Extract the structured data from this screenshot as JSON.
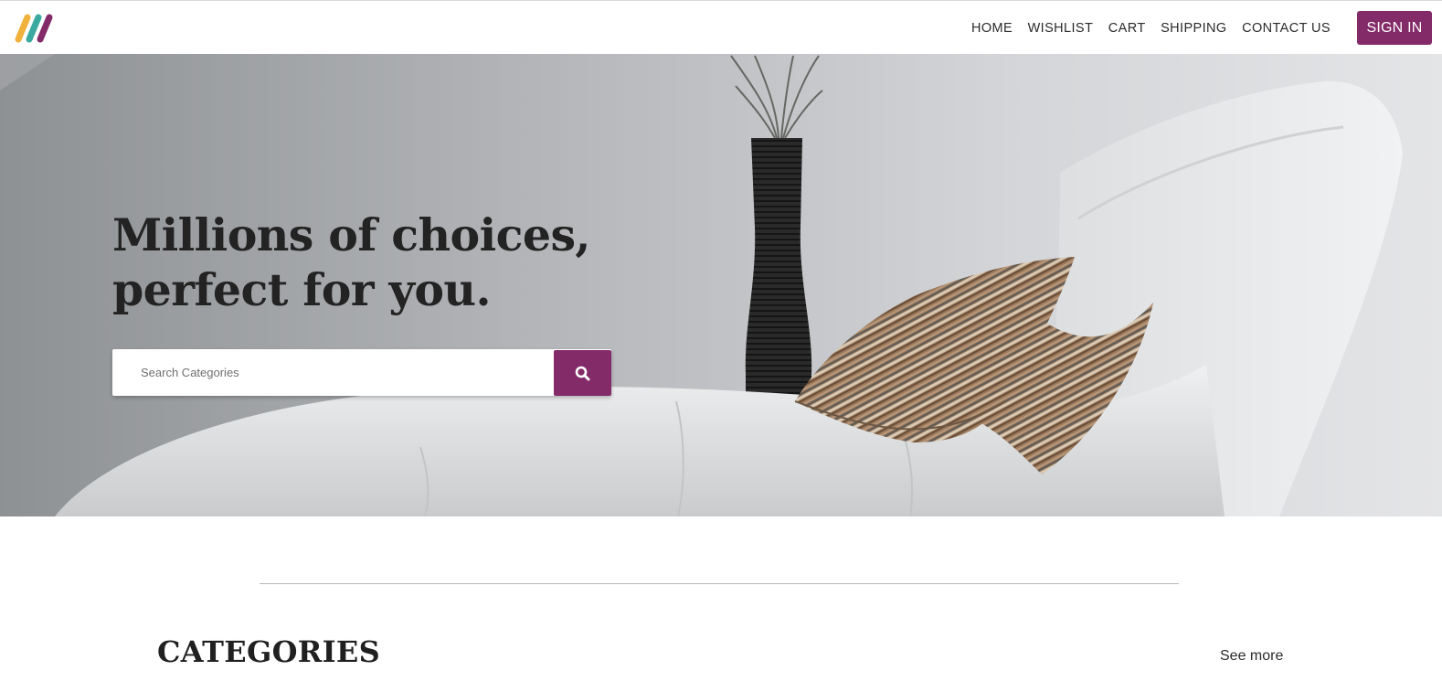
{
  "nav": {
    "logo_icon": "brand-stripes-logo",
    "links": [
      "HOME",
      "WISHLIST",
      "CART",
      "SHIPPING",
      "CONTACT US"
    ],
    "signin_label": "SIGN IN"
  },
  "hero": {
    "title": "Millions of choices, perfect for you.",
    "search_placeholder": "Search Categories",
    "search_icon": "search-icon"
  },
  "categories": {
    "title": "CATEGORIES",
    "see_more": "See more"
  },
  "colors": {
    "brand": "#832a68",
    "logo_yellow": "#f0b13d",
    "logo_teal": "#3aa99f",
    "logo_purple": "#832a68"
  }
}
